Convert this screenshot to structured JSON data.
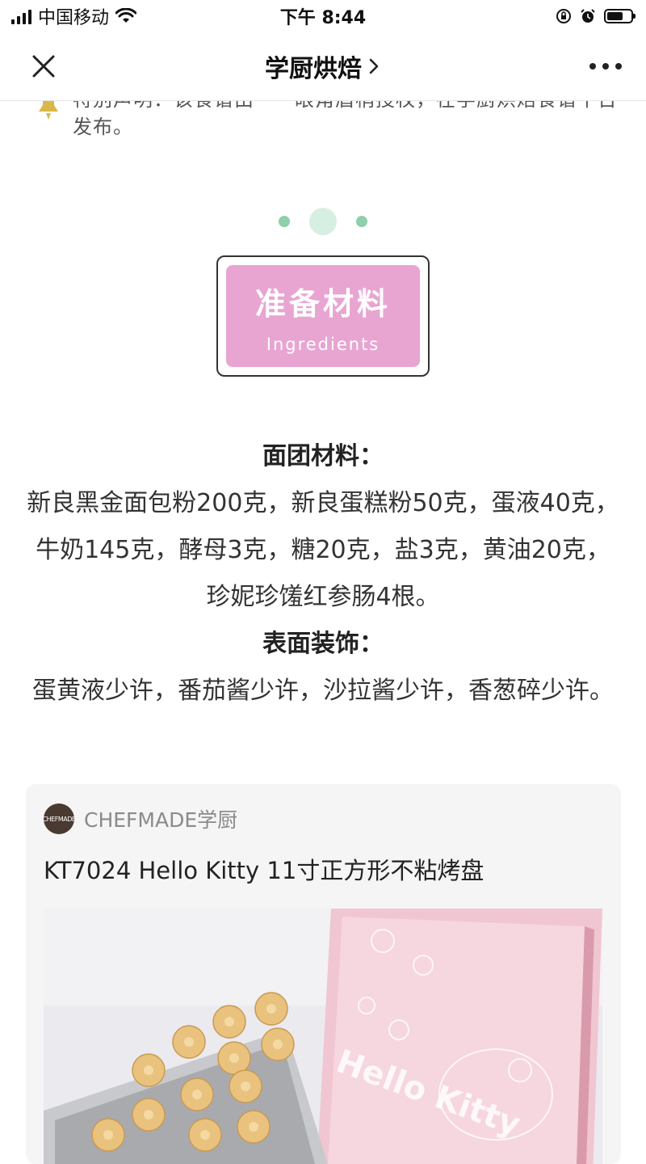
{
  "status_bar": {
    "carrier": "中国移动",
    "time": "下午 8:44"
  },
  "nav": {
    "title": "学厨烘焙"
  },
  "notice": {
    "text": "特别声明：该食谱由一一眼角眉梢授权，在学厨烘焙食谱平台发布。"
  },
  "section_badge": {
    "title": "准备材料",
    "subtitle": "Ingredients"
  },
  "ingredients": {
    "dough_heading": "面团材料：",
    "dough_text": "新良黑金面包粉200克，新良蛋糕粉50克，蛋液40克，牛奶145克，酵母3克，糖20克，盐3克，黄油20克，珍妮珍馐红参肠4根。",
    "topping_heading": "表面装饰：",
    "topping_text": "蛋黄液少许，番茄酱少许，沙拉酱少许，香葱碎少许。"
  },
  "product_card": {
    "brand_logo_text": "CHEFMADE",
    "brand": "CHEFMADE学厨",
    "title": "KT7024 Hello Kitty 11寸正方形不粘烤盘",
    "image_text": "Hello Kitty"
  },
  "colors": {
    "badge_pink": "#e8a5d2",
    "dot_green": "#8fcfac",
    "card_bg": "#f5f5f5"
  }
}
